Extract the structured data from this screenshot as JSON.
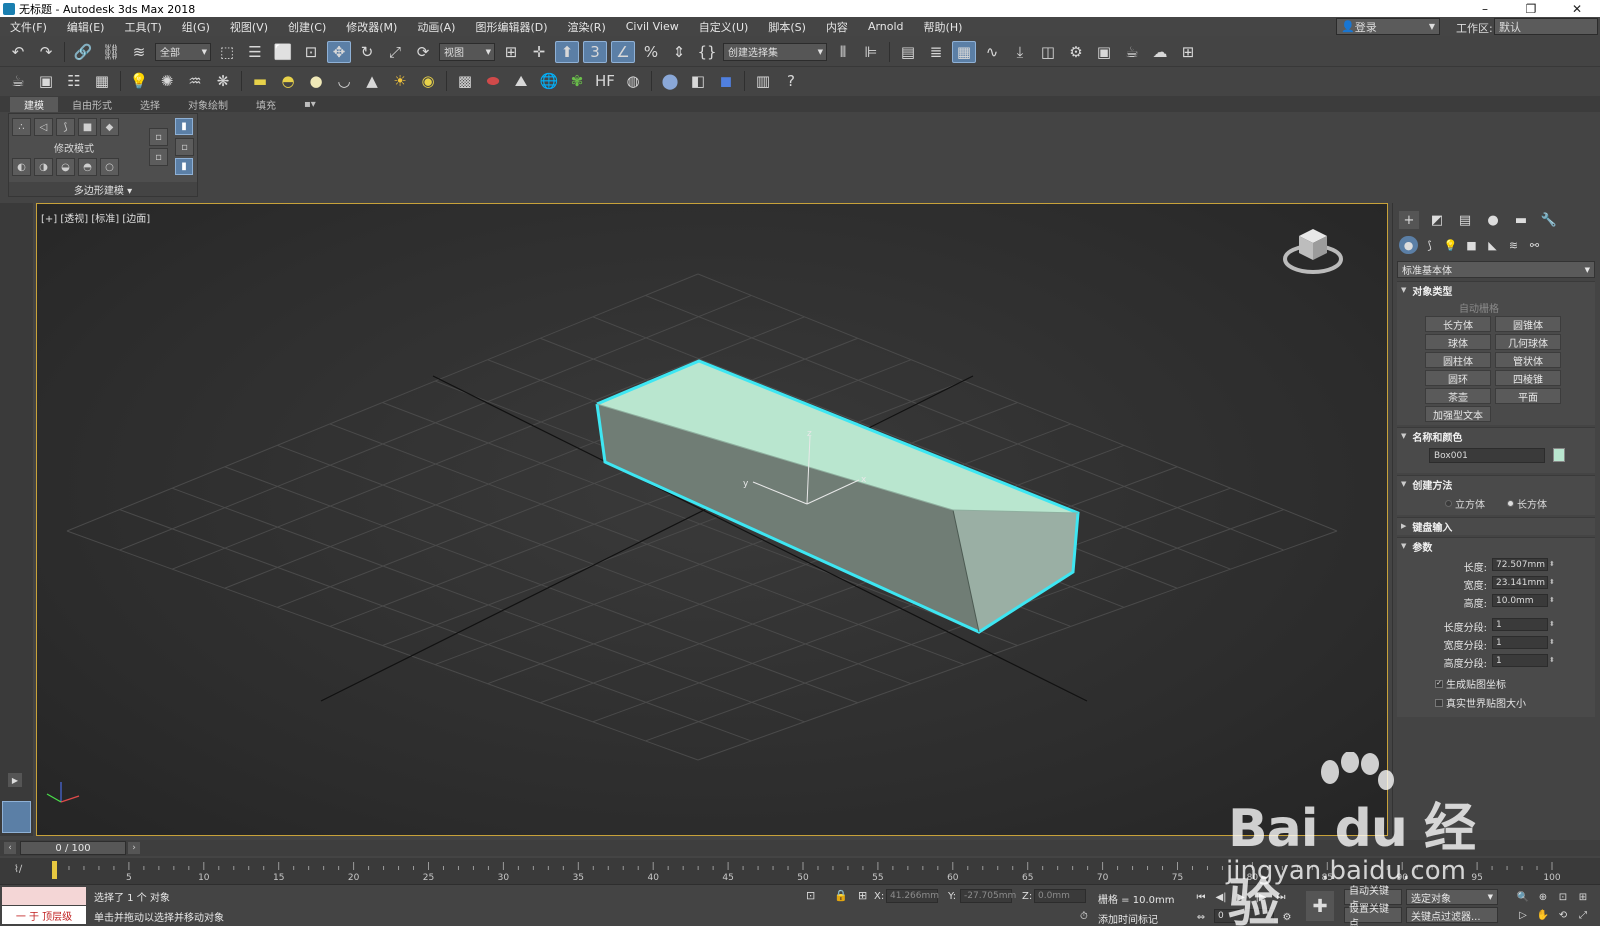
{
  "window": {
    "title": "无标题 - Autodesk 3ds Max 2018",
    "controls": [
      "–",
      "❐",
      "✕"
    ]
  },
  "menu": {
    "items": [
      "文件(F)",
      "编辑(E)",
      "工具(T)",
      "组(G)",
      "视图(V)",
      "创建(C)",
      "修改器(M)",
      "动画(A)",
      "图形编辑器(D)",
      "渲染(R)",
      "Civil View",
      "自定义(U)",
      "脚本(S)",
      "内容",
      "Arnold",
      "帮助(H)"
    ],
    "login_label": "登录",
    "workspace_label": "工作区:",
    "workspace_value": "默认"
  },
  "toolbar": {
    "selection_filter": "全部",
    "ref_coord": "视图",
    "named_selection": "创建选择集"
  },
  "ribbon": {
    "tabs": [
      "建模",
      "自由形式",
      "选择",
      "对象绘制",
      "填充"
    ],
    "active_tab": "建模",
    "modify_mode_label": "修改模式",
    "footer_label": "多边形建模 ▾"
  },
  "viewport": {
    "label": "[+] [透视] [标准] [边面]",
    "axis_labels": {
      "x": "x",
      "y": "y",
      "z": "z"
    },
    "object_color": "#b9e6cf",
    "selection_color": "#3ee6f2"
  },
  "command_panel": {
    "category": "标准基本体",
    "object_type": {
      "header": "对象类型",
      "autogrid": "自动栅格",
      "buttons": [
        "长方体",
        "圆锥体",
        "球体",
        "几何球体",
        "圆柱体",
        "管状体",
        "圆环",
        "四棱锥",
        "茶壶",
        "平面",
        "加强型文本"
      ]
    },
    "name_color": {
      "header": "名称和颜色",
      "name": "Box001"
    },
    "creation_method": {
      "header": "创建方法",
      "options": [
        "立方体",
        "长方体"
      ],
      "selected": "长方体"
    },
    "keyboard_entry": {
      "header": "键盘输入"
    },
    "parameters": {
      "header": "参数",
      "length_label": "长度:",
      "length": "72.507mm",
      "width_label": "宽度:",
      "width": "23.141mm",
      "height_label": "高度:",
      "height": "10.0mm",
      "length_segs_label": "长度分段:",
      "length_segs": "1",
      "width_segs_label": "宽度分段:",
      "width_segs": "1",
      "height_segs_label": "高度分段:",
      "height_segs": "1",
      "gen_map_coords": "生成贴图坐标",
      "real_world_map": "真实世界贴图大小"
    }
  },
  "timeline": {
    "frame_display": "0 / 100",
    "ticks": [
      5,
      10,
      15,
      20,
      25,
      30,
      35,
      40,
      45,
      50,
      55,
      60,
      65,
      70,
      75,
      80,
      85,
      90,
      95,
      100
    ]
  },
  "status": {
    "maxscript_text": "一 于 顶层级",
    "selected_text": "选择了 1 个 对象",
    "prompt_text": "单击并拖动以选择并移动对象",
    "x_label": "X:",
    "x_value": "41.266mm",
    "y_label": "Y:",
    "y_value": "-27.705mm",
    "z_label": "Z:",
    "z_value": "0.0mm",
    "grid_text": "栅格 = 10.0mm",
    "add_time_tag": "添加时间标记",
    "auto_key": "自动关键点",
    "selected_object": "选定对象",
    "set_key": "设置关键点",
    "key_filters": "关键点过滤器...",
    "current_frame": "0"
  },
  "watermark": {
    "logo_text": "Bai du 经验",
    "url": "jingyan.baidu.com"
  }
}
